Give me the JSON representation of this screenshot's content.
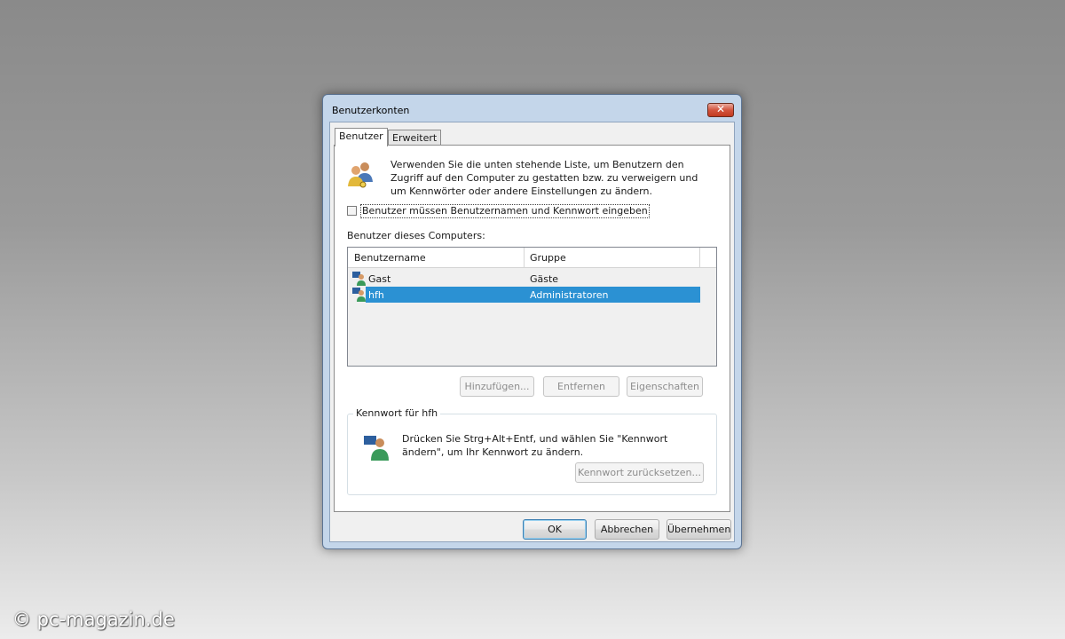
{
  "window": {
    "title": "Benutzerkonten",
    "close_label": "✕"
  },
  "tabs": [
    {
      "label": "Benutzer"
    },
    {
      "label": "Erweitert"
    }
  ],
  "intro_text": "Verwenden Sie die unten stehende Liste, um Benutzern den Zugriff auf den Computer zu gestatten bzw. zu verweigern und um Kennwörter oder andere Einstellungen zu ändern.",
  "require_login": {
    "label": "Benutzer müssen Benutzernamen und Kennwort eingeben",
    "checked": false
  },
  "users_section_label": "Benutzer dieses Computers:",
  "table": {
    "columns": [
      "Benutzername",
      "Gruppe"
    ],
    "rows": [
      {
        "name": "Gast",
        "group": "Gäste",
        "selected": false
      },
      {
        "name": "hfh",
        "group": "Administratoren",
        "selected": true
      }
    ]
  },
  "user_buttons": {
    "add": "Hinzufügen...",
    "remove": "Entfernen",
    "properties": "Eigenschaften"
  },
  "password_group": {
    "legend": "Kennwort für hfh",
    "text": "Drücken Sie Strg+Alt+Entf, und wählen Sie \"Kennwort ändern\", um Ihr Kennwort zu ändern.",
    "reset_button": "Kennwort zurücksetzen..."
  },
  "dialog_buttons": {
    "ok": "OK",
    "cancel": "Abbrechen",
    "apply": "Übernehmen"
  },
  "watermark": "© pc-magazin.de",
  "colors": {
    "selection": "#2b91d3",
    "window_frame": "#c4d6ea",
    "close_button": "#c23a20"
  }
}
